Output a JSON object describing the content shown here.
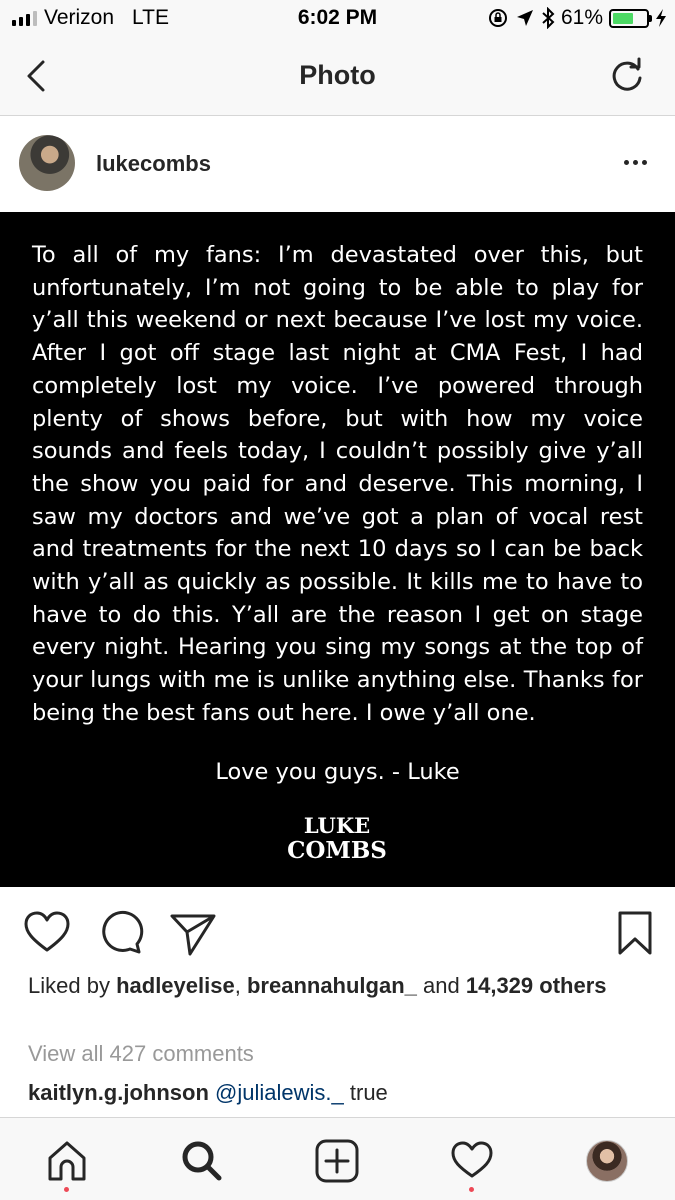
{
  "status_bar": {
    "carrier": "Verizon",
    "network": "LTE",
    "time": "6:02 PM",
    "battery_percent": "61%",
    "battery_level": 0.61,
    "icons": [
      "signal-icon",
      "lock-rotation-icon",
      "location-icon",
      "bluetooth-icon",
      "battery-icon",
      "charging-icon"
    ]
  },
  "nav": {
    "title": "Photo",
    "back_icon": "chevron-left-icon",
    "refresh_icon": "refresh-icon"
  },
  "post": {
    "username": "lukecombs",
    "more_icon": "more-horizontal-icon",
    "image_text": "To all of my fans: I’m devastated over this, but unfortunately, I’m not going to be able to play for y’all this weekend or next because I’ve lost my voice. After I got off stage last night at CMA Fest, I had completely lost my voice. I’ve powered through plenty of shows before, but with how my voice sounds and feels today, I couldn’t possibly give y’all the show you paid for and deserve. This morning, I saw my doctors and we’ve got a plan of vocal rest and treatments for the next 10 days so I can be back with y’all as quickly as possible. It kills me to have to have to do this. Y’all are the reason I get on stage every night. Hearing you sing my songs at the top of your lungs with me is unlike anything else. Thanks for being the best fans out here. I owe y’all one.",
    "image_signoff": "Love you guys. - Luke",
    "image_logo_line1": "LUKE",
    "image_logo_line2": "COMBS",
    "likes_prefix": "Liked by",
    "liker1": "hadleyelise",
    "liker_sep": ",",
    "liker2": "breannahulgan_",
    "likes_and": "and",
    "likes_count": "14,329",
    "likes_suffix": "others",
    "view_comments": "View all 427 comments",
    "comment": {
      "user": "kaitlyn.g.johnson",
      "mention": "@julialewis._",
      "text": "true"
    }
  },
  "actions": [
    "heart-icon",
    "comment-icon",
    "share-icon",
    "bookmark-icon"
  ],
  "tab_bar": [
    "home-icon",
    "search-icon",
    "add-icon",
    "activity-icon",
    "profile-avatar"
  ],
  "colors": {
    "bar_bg": "#f8f8f8",
    "text": "#262626",
    "muted": "#999999",
    "mention": "#003569",
    "battery": "#4cd964",
    "notification_dot": "#ed4956"
  }
}
